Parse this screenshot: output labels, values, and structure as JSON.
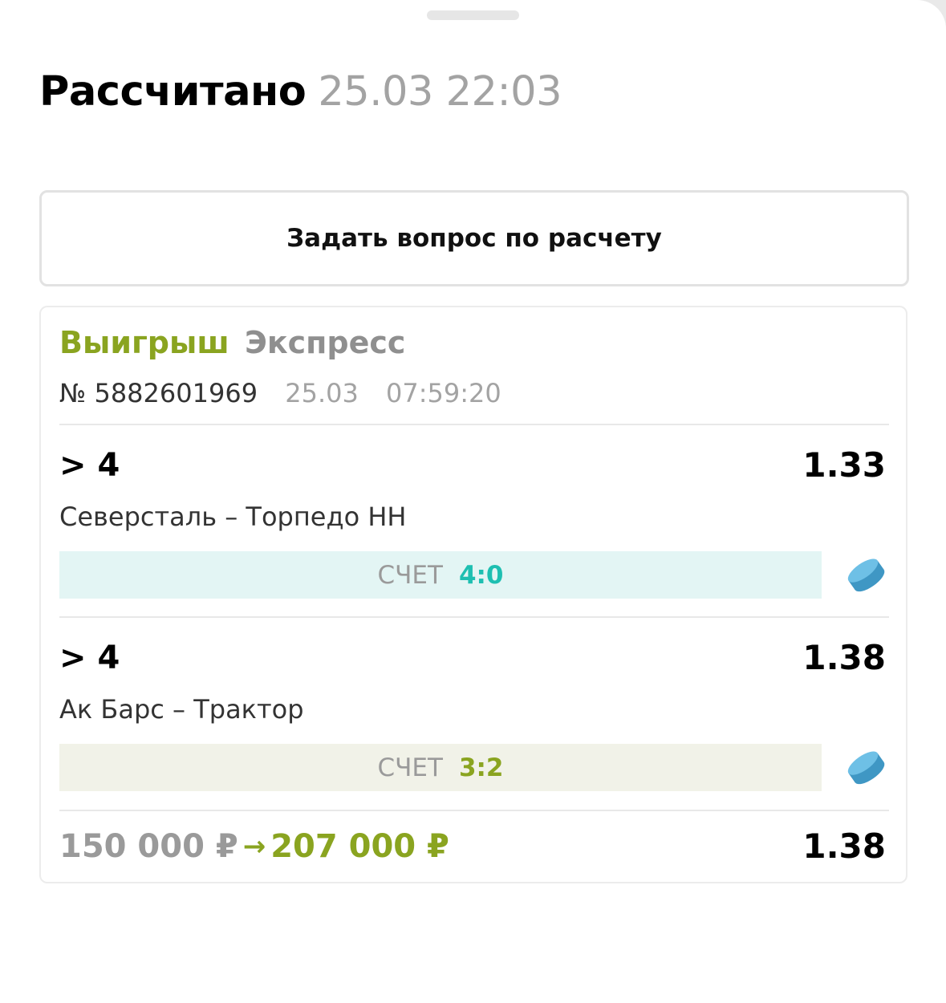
{
  "header": {
    "title": "Рассчитано",
    "datetime": "25.03 22:03"
  },
  "ask_button": {
    "label": "Задать вопрос по расчету"
  },
  "bet": {
    "status": "Выигрыш",
    "type": "Экспресс",
    "number": "№ 5882601969",
    "date": "25.03",
    "time": "07:59:20",
    "selections": [
      {
        "market": "> 4",
        "odds": "1.33",
        "event": "Северсталь – Торпедо НН",
        "score_label": "СЧЕТ",
        "score": "4:0",
        "sport_icon": "hockey-puck-icon",
        "accent": "#1dbfb1"
      },
      {
        "market": "> 4",
        "odds": "1.38",
        "event": "Ак Барс – Трактор",
        "score_label": "СЧЕТ",
        "score": "3:2",
        "sport_icon": "hockey-puck-icon",
        "accent": "#8aa420"
      }
    ],
    "summary": {
      "stake": "150 000 ₽",
      "arrow": "→",
      "payout": "207 000 ₽",
      "total_odds": "1.38"
    }
  },
  "colors": {
    "win_green": "#8aa420",
    "teal": "#1dbfb1",
    "muted_gray": "#a3a3a3",
    "puck_blue": "#49a9d6"
  }
}
